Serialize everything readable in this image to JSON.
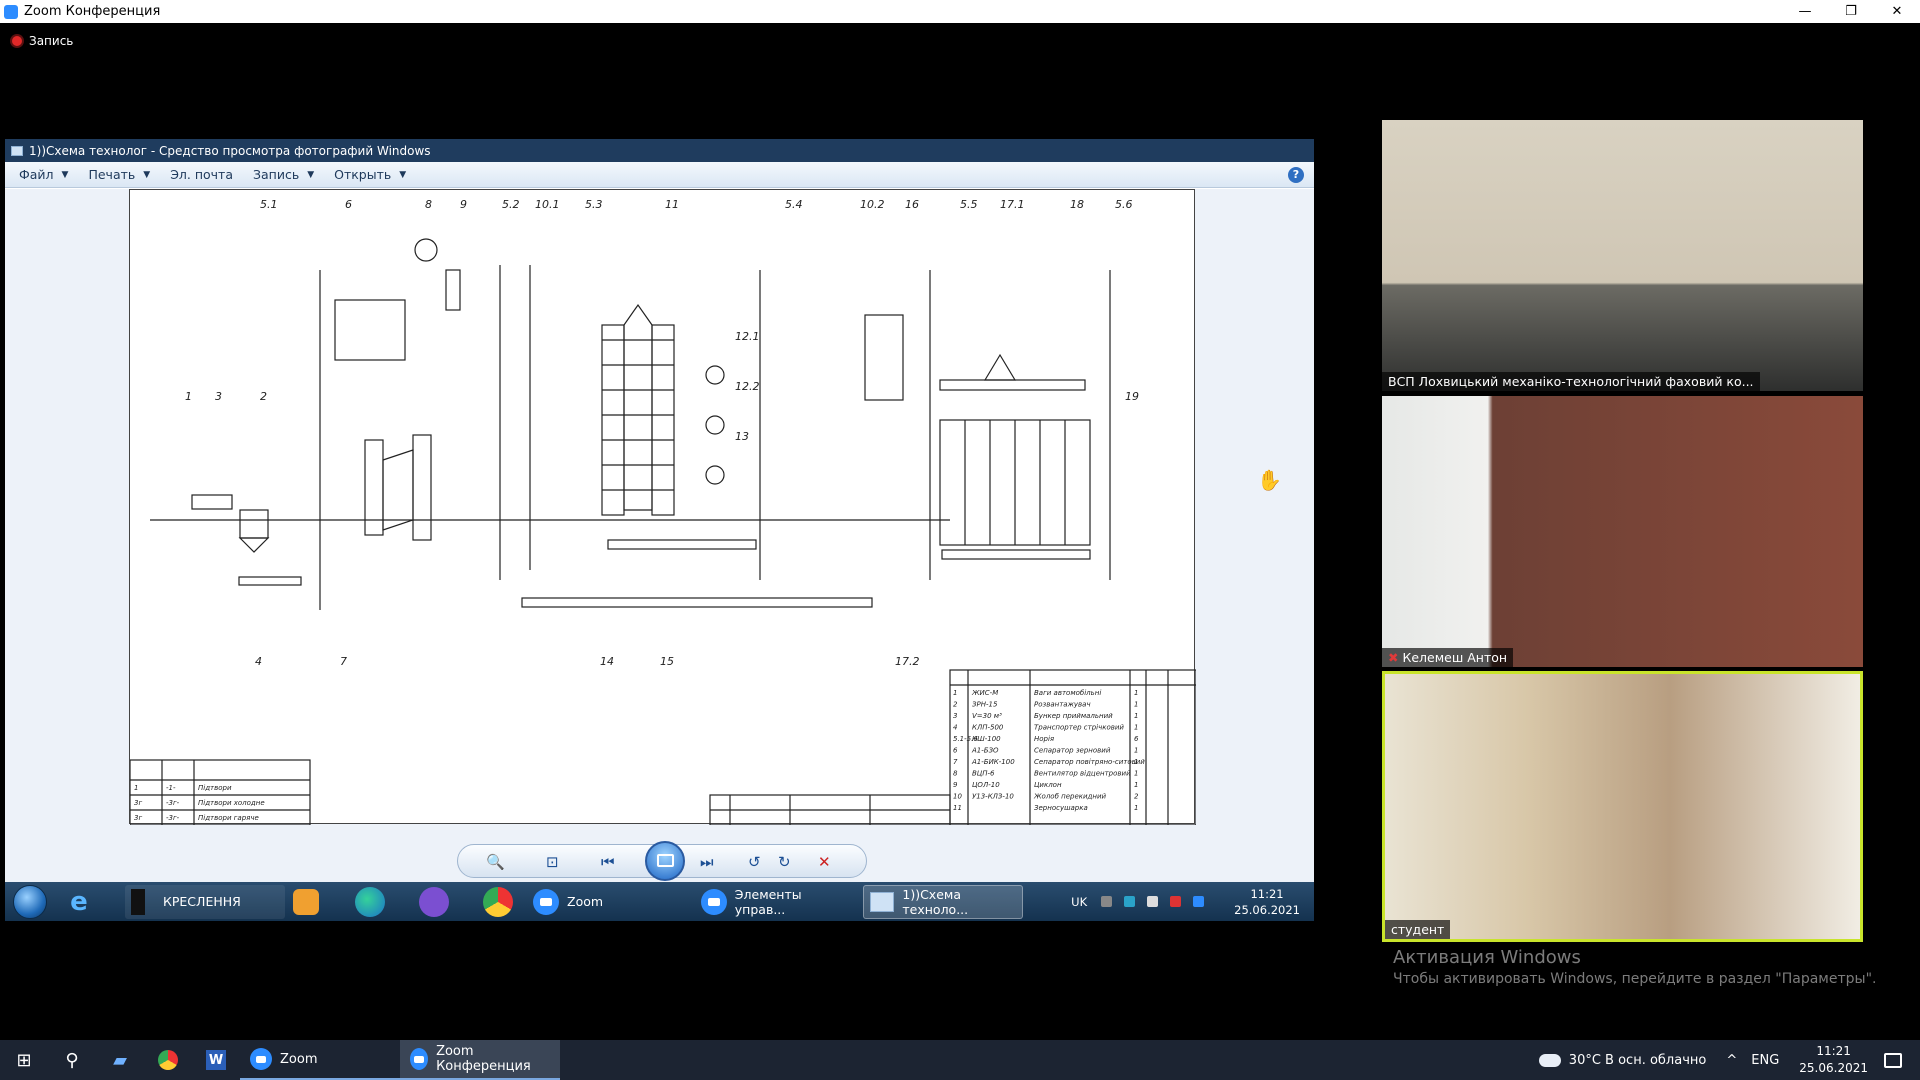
{
  "zoom_window": {
    "title": "Zoom Конференция",
    "minimize": "—",
    "restore": "❐",
    "close": "✕"
  },
  "recording": {
    "label": "Запись"
  },
  "viewer": {
    "title": "1))Схема технолог - Средство просмотра фотографий Windows",
    "menu": [
      {
        "label": "Файл"
      },
      {
        "label": "Печать"
      },
      {
        "label": "Эл. почта"
      },
      {
        "label": "Запись"
      },
      {
        "label": "Открыть"
      }
    ],
    "help": "?"
  },
  "drawing": {
    "labels": [
      "5.1",
      "6",
      "8",
      "9",
      "5.2",
      "10.1",
      "5.3",
      "11",
      "5.4",
      "10.2",
      "16",
      "5.5",
      "17.1",
      "18",
      "5.6",
      "12.1",
      "12.2",
      "13",
      "19",
      "1",
      "3",
      "2",
      "4",
      "7",
      "14",
      "15",
      "17.2"
    ],
    "legend_rows": [
      [
        "1",
        "-1-",
        "Підтвори"
      ],
      [
        "3г",
        "-3г-",
        "Підтвори холодне"
      ],
      [
        "3г",
        "-3г-",
        "Підтвори гаряче"
      ]
    ],
    "spec_rows": [
      [
        "1",
        "ЖИС-М",
        "Ваги автомобільні",
        "1"
      ],
      [
        "2",
        "ЗРН-15",
        "Розвантажувач",
        "1"
      ],
      [
        "3",
        "V=30 м³",
        "Бункер приймальний",
        "1"
      ],
      [
        "4",
        "КЛП-500",
        "Транспортер стрічковий",
        "1"
      ],
      [
        "5.1-5.6",
        "НШ-100",
        "Норія",
        "6"
      ],
      [
        "6",
        "А1-БЗО",
        "Сепаратор зерновий",
        "1"
      ],
      [
        "7",
        "А1-БИК-100",
        "Сепаратор повітряно-ситовий",
        "1"
      ],
      [
        "8",
        "ВЦП-6",
        "Вентилятор відцентровий",
        "1"
      ],
      [
        "9",
        "ЦОЛ-10",
        "Циклон",
        "1"
      ],
      [
        "10",
        "У13-КЛЗ-10",
        "Жолоб перекидний",
        "2"
      ],
      [
        "11",
        "",
        "Зерносушарка",
        "1"
      ]
    ]
  },
  "taskbar_inner": {
    "tasks": [
      {
        "label": "КРЕСЛЕННЯ"
      },
      {
        "label": "Zoom"
      },
      {
        "label": "Элементы управ..."
      },
      {
        "label": "1))Схема техноло..."
      }
    ],
    "lang": "UK",
    "time": "11:21",
    "date": "25.06.2021"
  },
  "participants": [
    {
      "name": "ВСП Лохвицький механіко-технологічний фаховий ко..."
    },
    {
      "name": "Келемеш Антон"
    },
    {
      "name": "студент"
    }
  ],
  "activation": {
    "title": "Активация Windows",
    "text": "Чтобы активировать Windows, перейдите в раздел \"Параметры\"."
  },
  "taskbar": {
    "tasks": [
      {
        "label": "Zoom"
      },
      {
        "label": "Zoom Конференция"
      }
    ],
    "weather": "30°C  В осн. облачно",
    "lang": "ENG",
    "time": "11:21",
    "date": "25.06.2021"
  }
}
